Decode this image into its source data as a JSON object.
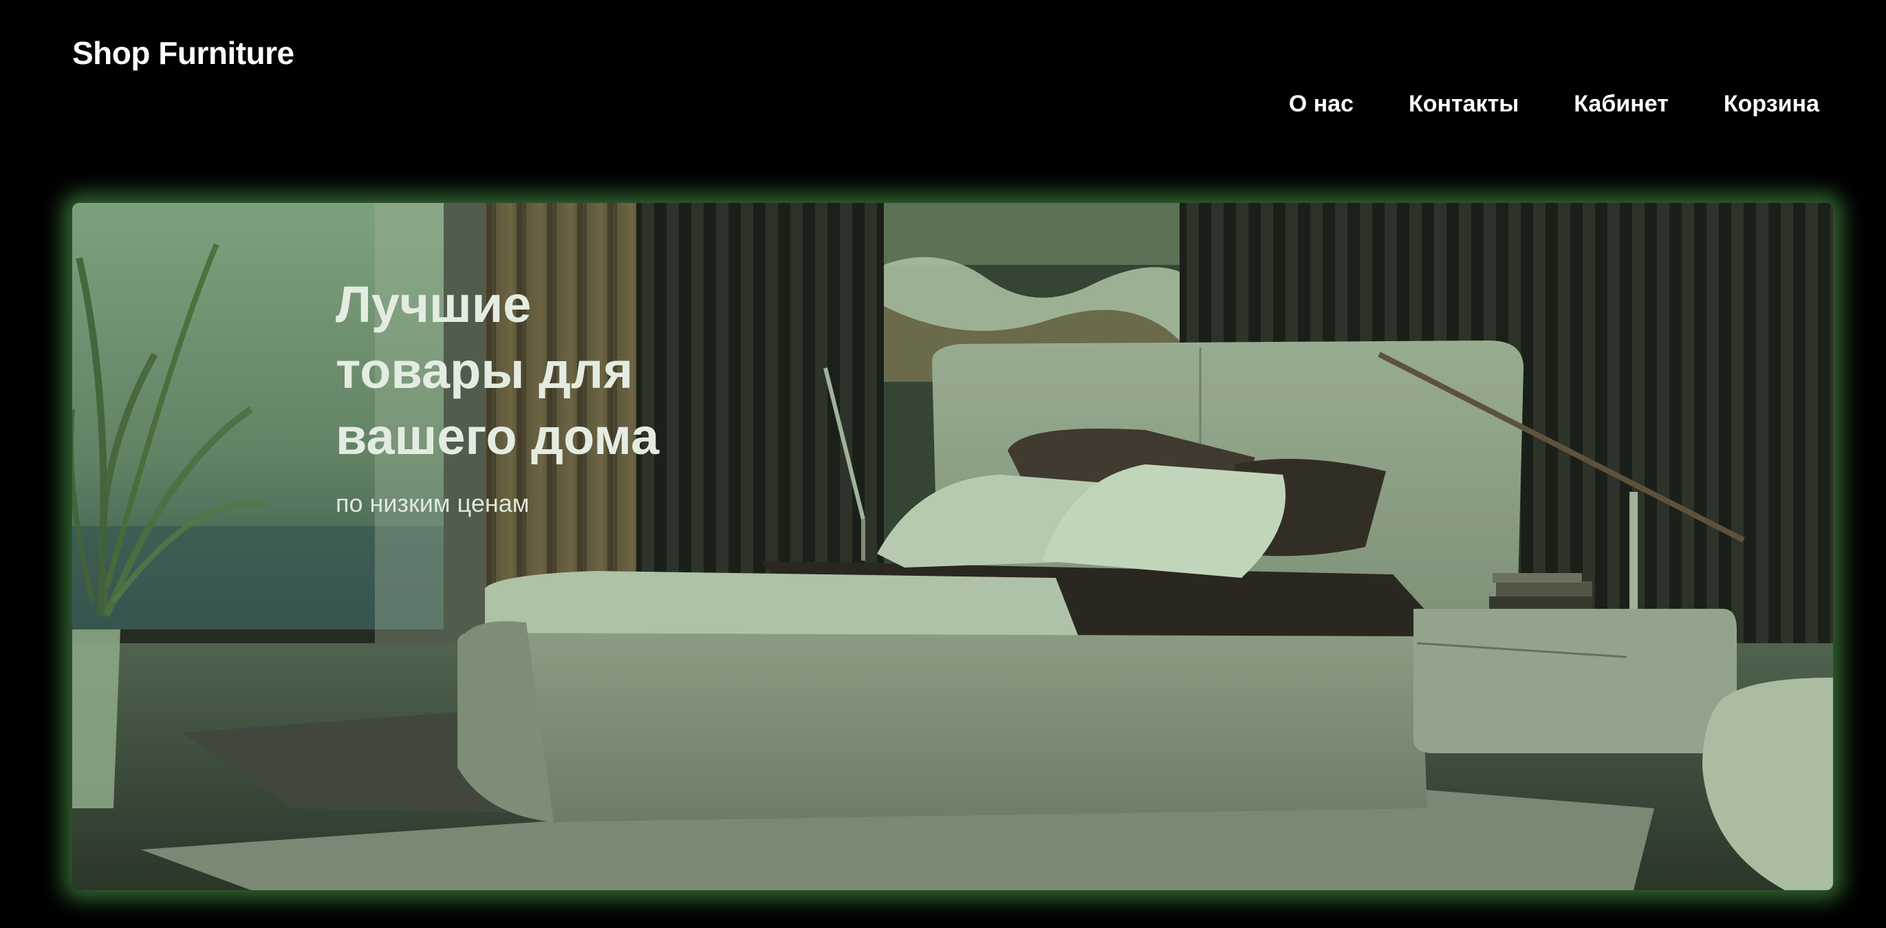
{
  "header": {
    "logo": "Shop Furniture"
  },
  "nav": {
    "items": [
      {
        "label": "О нас",
        "name": "nav-about"
      },
      {
        "label": "Контакты",
        "name": "nav-contacts"
      },
      {
        "label": "Кабинет",
        "name": "nav-account"
      },
      {
        "label": "Корзина",
        "name": "nav-cart"
      }
    ]
  },
  "hero": {
    "title_lines": [
      "Лучшие",
      "товары для",
      "вашего дома"
    ],
    "subtitle": "по низким ценам",
    "glow_color": "#5ab45a"
  }
}
